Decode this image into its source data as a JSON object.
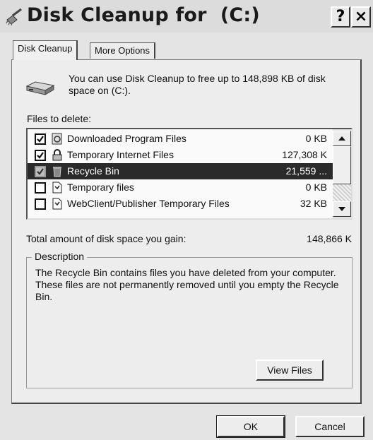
{
  "window": {
    "title": "Disk Cleanup for  (C:)",
    "help_label": "?",
    "close_label": "×"
  },
  "tabs": [
    {
      "label": "Disk Cleanup",
      "active": true
    },
    {
      "label": "More Options",
      "active": false
    }
  ],
  "main": {
    "info_text": "You can use Disk Cleanup to free up to 148,898 KB of disk space on  (C:).",
    "files_label": "Files to delete:",
    "files": [
      {
        "name": "Downloaded Program Files",
        "size": "0 KB",
        "checked": true,
        "selected": false,
        "icon": "activex-file-icon"
      },
      {
        "name": "Temporary Internet Files",
        "size": "127,308 K",
        "checked": true,
        "selected": false,
        "icon": "lock-icon"
      },
      {
        "name": "Recycle Bin",
        "size": "21,559 ...",
        "checked": true,
        "selected": true,
        "icon": "recycle-bin-icon"
      },
      {
        "name": "Temporary files",
        "size": "0 KB",
        "checked": false,
        "selected": false,
        "icon": "document-icon"
      },
      {
        "name": "WebClient/Publisher Temporary Files",
        "size": "32 KB",
        "checked": false,
        "selected": false,
        "icon": "document-icon"
      }
    ],
    "total_label": "Total amount of disk space you gain:",
    "total_value": "148,866 K",
    "description_legend": "Description",
    "description_text": "The Recycle Bin contains files you have deleted from your computer. These files are not permanently removed until you empty the Recycle Bin.",
    "view_files_label": "View Files"
  },
  "footer": {
    "ok_label": "OK",
    "cancel_label": "Cancel"
  }
}
